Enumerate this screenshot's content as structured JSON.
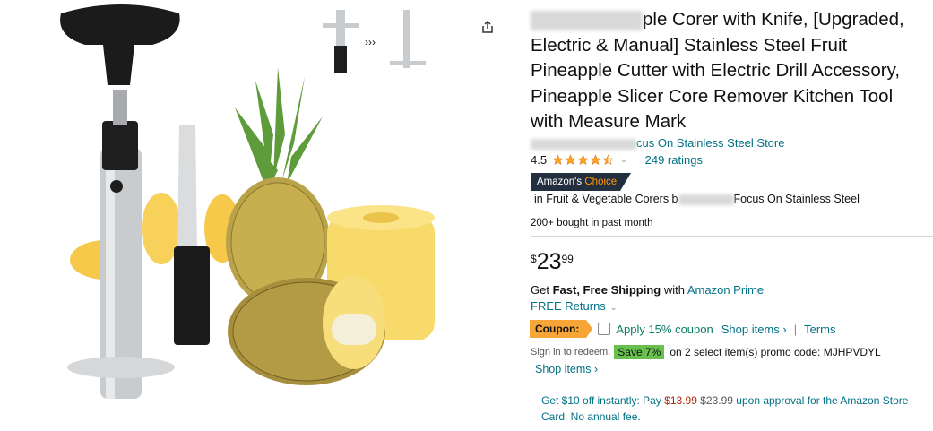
{
  "product": {
    "title_visible": "ple Corer with Knife, [Upgraded, Electric & Manual] Stainless Steel Fruit Pineapple Cutter with Electric Drill Accessory, Pineapple Slicer Core Remover Kitchen Tool with Measure Mark",
    "store_link": "cus On Stainless Steel Store",
    "rating_value": "4.5",
    "rating_stars": 4.5,
    "ratings_count": "249 ratings",
    "badge_prefix": "Amazon's",
    "badge_suffix": "Choice",
    "category_prefix": "in Fruit & Vegetable Corers b",
    "category_suffix": "Focus On Stainless Steel",
    "bought": "200+ bought in past month"
  },
  "price": {
    "symbol": "$",
    "whole": "23",
    "fraction": "99"
  },
  "shipping": {
    "get": "Get",
    "fast_free": "Fast, Free Shipping",
    "with": "with",
    "prime": "Amazon Prime",
    "returns": "FREE Returns"
  },
  "coupon": {
    "tag": "Coupon:",
    "apply": "Apply 15% coupon",
    "shop_items": "Shop items ›",
    "sep": "|",
    "terms": "Terms"
  },
  "promo": {
    "signin": "Sign in to redeem.",
    "save": "Save 7%",
    "text": "on 2 select item(s) promo code: MJHPVDYL",
    "shop_items": "Shop items ›"
  },
  "offer": {
    "part1": "Get $10 off instantly: Pay",
    "new_price": "$13.99",
    "old_price": "$23.99",
    "part2": "upon approval for the Amazon Store Card. No annual fee."
  },
  "colors": {
    "link": "#007185",
    "star": "#FFA41C",
    "badge": "#232F3E",
    "coupon": "#F7A536",
    "save": "#6AC04F",
    "price_red": "#B12704"
  },
  "icons": {
    "share": "share-icon",
    "stars": "star-icon",
    "dropdown": "chevron-down-icon"
  }
}
